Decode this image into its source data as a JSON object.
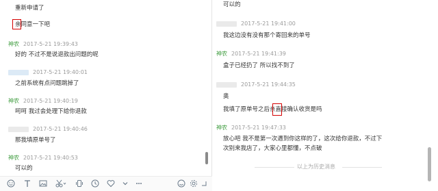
{
  "left": {
    "messages": [
      {
        "type": "text",
        "text": "重新申请了"
      },
      {
        "type": "text",
        "text": "亲同意一下吧"
      },
      {
        "type": "meta",
        "sender": "神农",
        "time": "2017-5-21 19:39:43"
      },
      {
        "type": "text",
        "text": "好的 不过不是说退款出问题的呢"
      },
      {
        "type": "meta",
        "sender": "",
        "time": "2017-5-21 19:40:01"
      },
      {
        "type": "text",
        "text": "之前系统有点问题跳掉了"
      },
      {
        "type": "meta",
        "sender": "神农",
        "time": "2017-5-21 19:40:19"
      },
      {
        "type": "text",
        "text": "呵呵 我过会处理下给你退款"
      },
      {
        "type": "meta",
        "sender": "",
        "time": "2017-5-21 19:40:46"
      },
      {
        "type": "text",
        "text": "那我填原单号了"
      },
      {
        "type": "meta",
        "sender": "神农",
        "time": "2017-5-21 19:40:53"
      },
      {
        "type": "text",
        "text": "可以的"
      }
    ],
    "toolbar_icons": [
      "emoji-icon",
      "font-icon",
      "image-icon",
      "scissors-icon",
      "shake-icon",
      "history-icon",
      "heart-icon",
      "chevron-down-icon",
      "more-icon",
      "smile-icon",
      "settings-icon",
      "expand-icon"
    ]
  },
  "right": {
    "messages": [
      {
        "type": "text",
        "text": "可以的"
      },
      {
        "type": "meta",
        "sender": "",
        "time": "2017-5-21 19:41:00"
      },
      {
        "type": "text",
        "text": "我这边没有没有那个寄回来的单号"
      },
      {
        "type": "meta",
        "sender": "神农",
        "time": "2017-5-21 19:41:39"
      },
      {
        "type": "text",
        "text": "盒子已经扔了 所以找不到了"
      },
      {
        "type": "meta",
        "sender": "",
        "time": "2017-5-21 19:44:35"
      },
      {
        "type": "text",
        "text": "奥"
      },
      {
        "type": "text",
        "text": "我填了原单号之后亲直接确认收货是吗"
      },
      {
        "type": "meta",
        "sender": "神农",
        "time": "2017-5-21 19:47:33"
      },
      {
        "type": "text",
        "text": "放心吧 我不是第一次遇到你这样的了，这次给你退款，不过下"
      },
      {
        "type": "text",
        "text": "次别来我店了，大家心里都懂，不点破"
      }
    ],
    "history_label": "以上为历史消息"
  },
  "colors": {
    "sender": "#3a9a3a",
    "meta": "#9a9a9a",
    "highlight": "#d40000",
    "text": "#333333"
  }
}
